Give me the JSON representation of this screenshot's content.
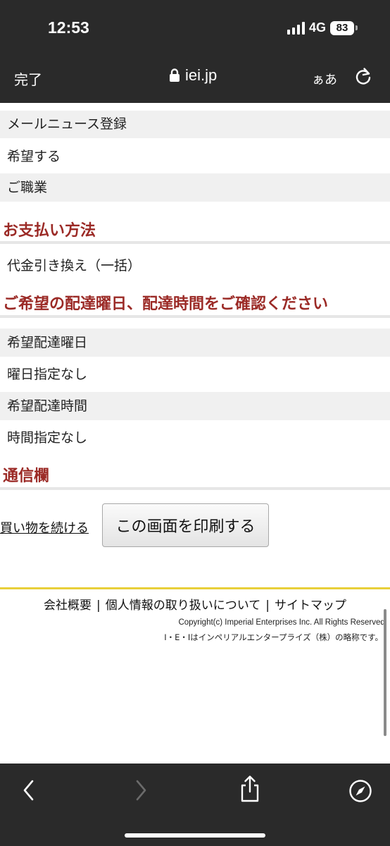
{
  "status_bar": {
    "time": "12:53",
    "network": "4G",
    "battery": "83"
  },
  "browser": {
    "done_label": "完了",
    "url": "iei.jp",
    "text_size_label": "ぁあ",
    "icons": [
      "lock-icon",
      "reload-icon",
      "back-icon",
      "forward-icon",
      "share-icon",
      "compass-icon"
    ]
  },
  "page": {
    "rows": {
      "mail_news_label": "メールニュース登録",
      "mail_news_value": "希望する",
      "occupation_label": "ご職業"
    },
    "payment": {
      "heading": "お支払い方法",
      "value": "代金引き換え（一括）"
    },
    "delivery": {
      "heading": "ご希望の配達曜日、配達時間をご確認ください",
      "day_label": "希望配達曜日",
      "day_value": "曜日指定なし",
      "time_label": "希望配達時間",
      "time_value": "時間指定なし"
    },
    "communication": {
      "heading": "通信欄"
    },
    "actions": {
      "continue_shopping": "買い物を続ける",
      "print_button": "この画面を印刷する"
    },
    "footer": {
      "links": [
        "会社概要",
        "個人情報の取り扱いについて",
        "サイトマップ"
      ],
      "separator": "|",
      "copyright": "Copyright(c) Imperial Enterprises Inc. All Rights Reserved.",
      "trademark": "I・E・Iはインペリアルエンタープライズ（株）の略称です。"
    }
  },
  "colors": {
    "chrome_bg": "#2a2a2a",
    "heading_red": "#9b2a26",
    "row_gray": "#f0f0f0",
    "footer_accent": "#e8cf3a"
  }
}
